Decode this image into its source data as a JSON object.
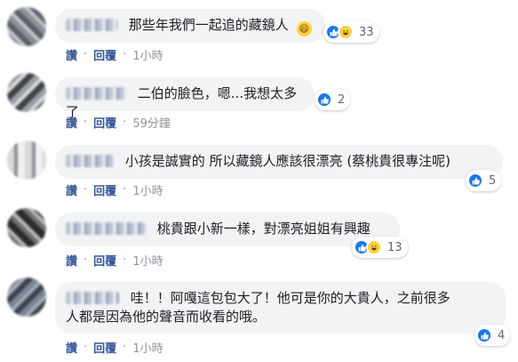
{
  "comments": [
    {
      "text": "那些年我們一起追的藏鏡人",
      "emoji": "😄",
      "reactions": [
        "like",
        "haha"
      ],
      "count": "33",
      "reply": "讚",
      "respond": "回覆",
      "time": "1小時"
    },
    {
      "text": "二伯的臉色，嗯...我想太多了",
      "reactions": [
        "like"
      ],
      "count": "2",
      "reply": "讚",
      "respond": "回覆",
      "time": "59分鐘"
    },
    {
      "text": "小孩是誠實的 所以藏鏡人應該很漂亮 (蔡桃貴很專注呢)",
      "reactions": [
        "like"
      ],
      "count": "5",
      "reply": "讚",
      "respond": "回覆",
      "time": "1小時"
    },
    {
      "text": "桃貴跟小新一樣，對漂亮姐姐有興趣",
      "reactions": [
        "like",
        "haha"
      ],
      "count": "13",
      "reply": "讚",
      "respond": "回覆",
      "time": "1小時"
    },
    {
      "text_line1": "哇！！阿嘎這包包大了！他可是你的大貴人，之前很多",
      "text_line2": "人都是因為他的聲音而收看的哦。",
      "reactions": [
        "like"
      ],
      "count": "4",
      "reply": "讚",
      "respond": "回覆",
      "time": "1小時"
    }
  ],
  "icons": {
    "like": "like-icon",
    "haha": "haha-icon"
  },
  "colors": {
    "bubble": "#f2f3f5",
    "like": "#1877f2",
    "haha": "#ffd23b",
    "link": "#385898"
  }
}
